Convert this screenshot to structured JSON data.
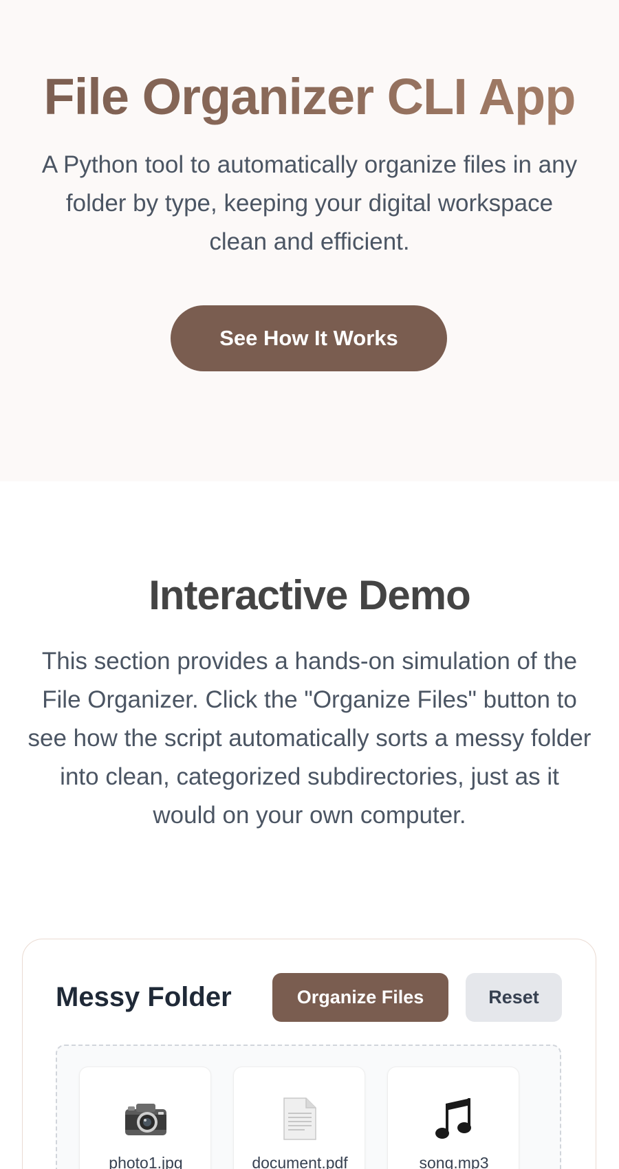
{
  "hero": {
    "title": "File Organizer CLI App",
    "subtitle": "A Python tool to automatically organize files in any folder by type, keeping your digital workspace clean and efficient.",
    "cta_label": "See How It Works"
  },
  "demo": {
    "title": "Interactive Demo",
    "description": "This section provides a hands-on simulation of the File Organizer. Click the \"Organize Files\" button to see how the script automatically sorts a messy folder into clean, categorized subdirectories, just as it would on your own computer.",
    "card": {
      "title": "Messy Folder",
      "organize_label": "Organize Files",
      "reset_label": "Reset",
      "files": [
        {
          "name": "photo1.jpg",
          "icon": "camera-icon"
        },
        {
          "name": "document.pdf",
          "icon": "document-icon"
        },
        {
          "name": "song.mp3",
          "icon": "music-note-icon"
        }
      ]
    }
  },
  "colors": {
    "brand": "#7a5d50",
    "hero_bg": "#fcf9f8",
    "reset_bg": "#e5e7eb"
  }
}
